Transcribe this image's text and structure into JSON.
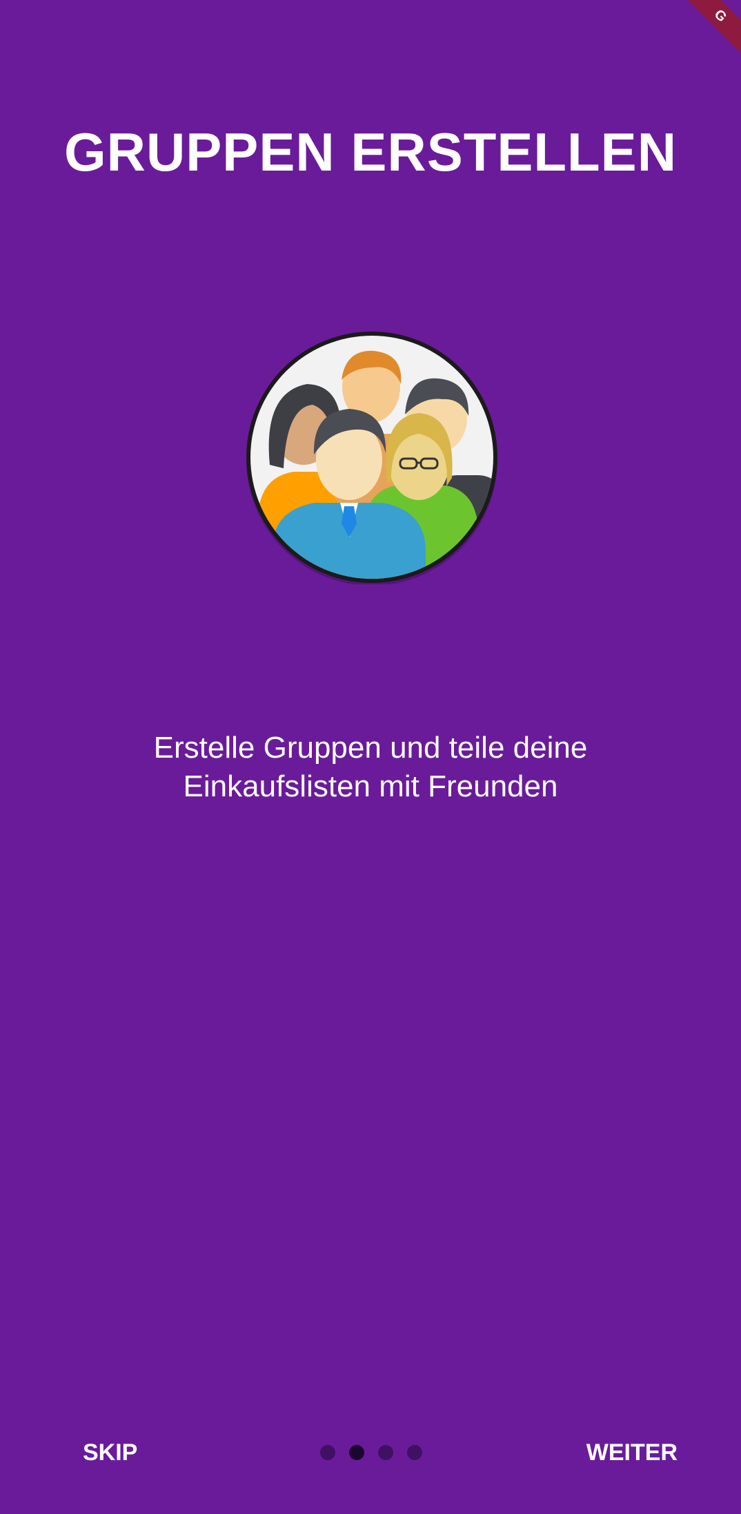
{
  "colors": {
    "background": "#6a1b9a",
    "banner": "#8e1b3f",
    "dot_inactive": "#3f1163",
    "dot_active": "#1c0630",
    "text": "#ffffff"
  },
  "banner": {
    "label": "G"
  },
  "title": "GRUPPEN ERSTELLEN",
  "illustration": {
    "icon": "group-people-icon"
  },
  "description": {
    "line1": "Erstelle Gruppen und teile deine",
    "line2": "Einkaufslisten mit Freunden"
  },
  "bottom_bar": {
    "skip_label": "SKIP",
    "next_label": "WEITER",
    "page_count": 4,
    "active_page": 2
  }
}
